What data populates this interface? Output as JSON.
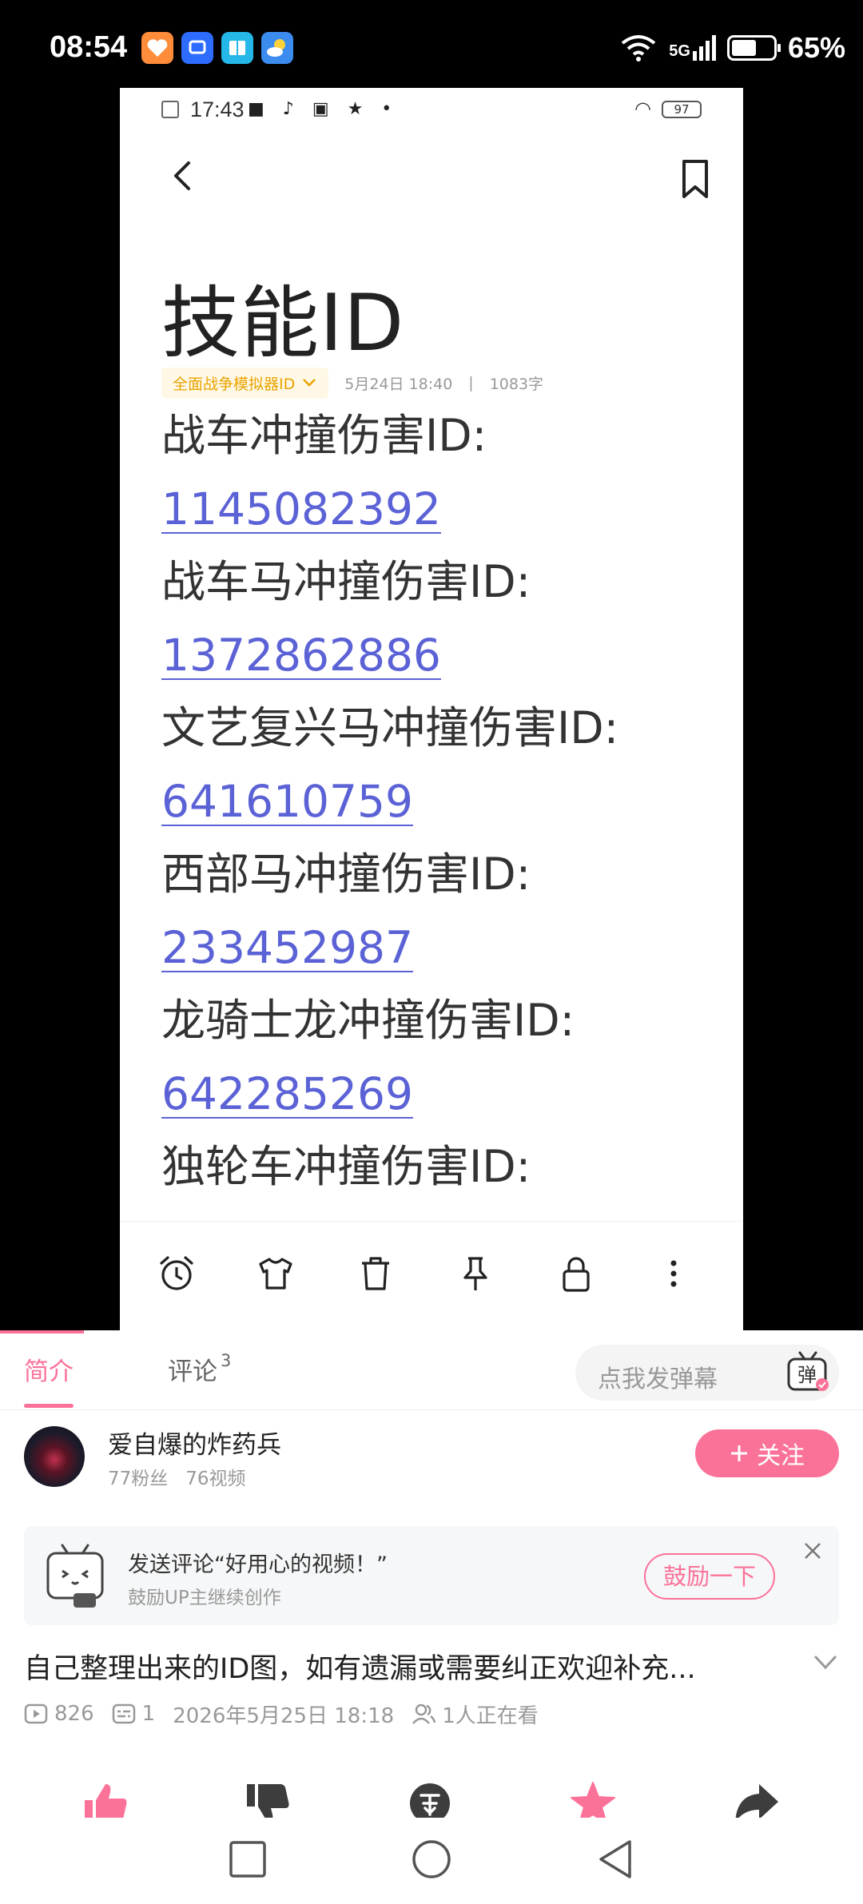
{
  "status_bar": {
    "time": "08:54",
    "network": "5G",
    "battery_percent": "65%",
    "battery_level": 0.65,
    "app_icons": [
      "health-app-icon",
      "appgallery-icon",
      "books-icon",
      "weather-icon"
    ]
  },
  "video_frame": {
    "status_time": "17:43",
    "battery": "97",
    "note_title": "技能ID",
    "folder": "全面战争模拟器ID",
    "date": "5月24日 18:40",
    "separator": "|",
    "word_count": "1083字",
    "lines": [
      {
        "text": "战车冲撞伤害ID:",
        "link": false
      },
      {
        "text": "1145082392",
        "link": true
      },
      {
        "text": "战车马冲撞伤害ID:",
        "link": false
      },
      {
        "text": "1372862886",
        "link": true
      },
      {
        "text": "文艺复兴马冲撞伤害ID:",
        "link": false
      },
      {
        "text": "641610759",
        "link": true
      },
      {
        "text": "西部马冲撞伤害ID:",
        "link": false
      },
      {
        "text": "233452987",
        "link": true
      },
      {
        "text": "龙骑士龙冲撞伤害ID:",
        "link": false
      },
      {
        "text": "642285269",
        "link": true
      },
      {
        "text": "独轮车冲撞伤害ID:",
        "link": false
      }
    ],
    "toolbar_icons": [
      "alarm-icon",
      "shirt-icon",
      "trash-icon",
      "pin-icon",
      "lock-icon",
      "more-icon"
    ]
  },
  "tabs": {
    "intro": "简介",
    "comments": "评论",
    "comment_count": "3",
    "danmaku_placeholder": "点我发弹幕",
    "danmaku_button": "弹"
  },
  "uploader": {
    "name": "爱自爆的炸药兵",
    "fans": "77粉丝",
    "videos": "76视频",
    "follow_label": "关注"
  },
  "encourage": {
    "title": "发送评论“好用心的视频！”",
    "subtitle": "鼓励UP主继续创作",
    "button": "鼓励一下"
  },
  "video": {
    "title": "自己整理出来的ID图，如有遗漏或需要纠正欢迎补充...",
    "views": "826",
    "danmaku_count": "1",
    "publish_time": "2026年5月25日 18:18",
    "watching": "1人正在看"
  },
  "colors": {
    "accent": "#fb7299",
    "link": "#5b62d6",
    "folder": "#e8a400"
  }
}
